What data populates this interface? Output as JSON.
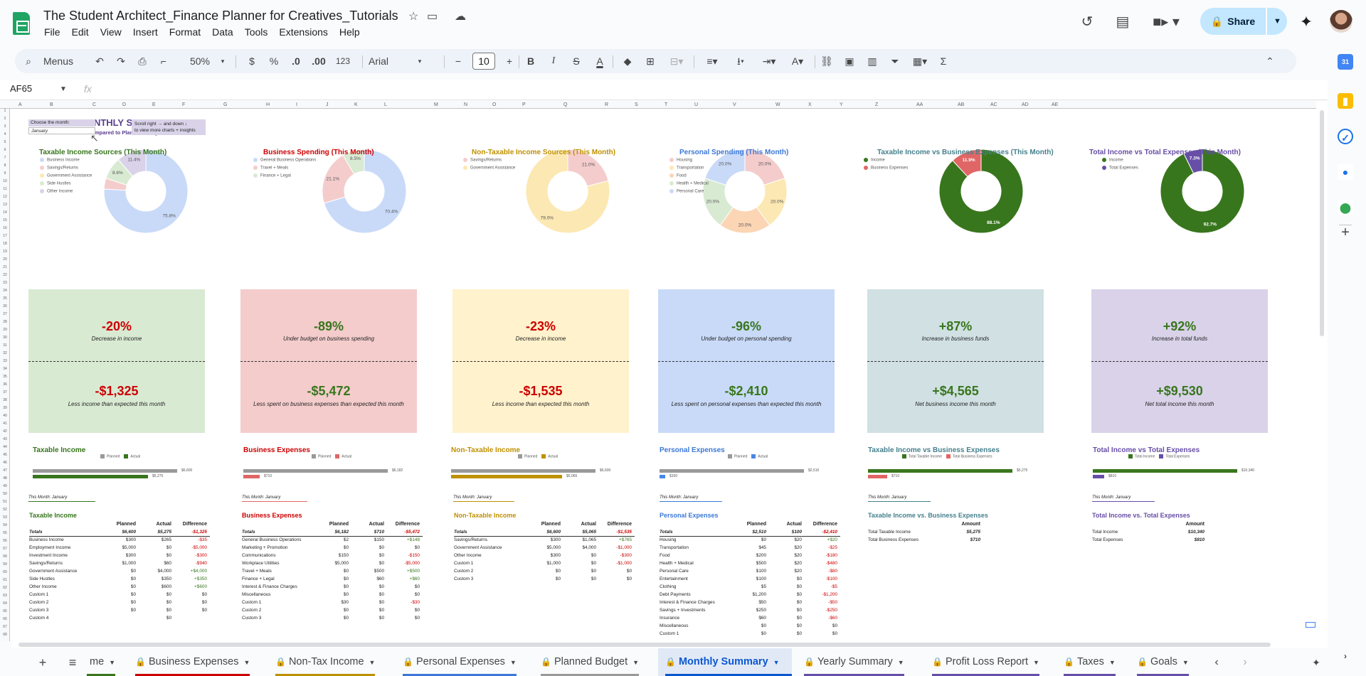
{
  "app": {
    "title": "The Student Architect_Finance Planner for Creatives_Tutorials",
    "menus": [
      "File",
      "Edit",
      "View",
      "Insert",
      "Format",
      "Data",
      "Tools",
      "Extensions",
      "Help"
    ],
    "share_label": "Share"
  },
  "toolbar": {
    "menus_label": "Menus",
    "zoom": "50%",
    "currency": "$",
    "percent": "%",
    "dec_decrease": ".0",
    "dec_increase": ".00",
    "number_format": "123",
    "font": "Arial",
    "font_size": "10",
    "bold": "B",
    "italic": "I",
    "strike": "S",
    "text_color": "A"
  },
  "formula_bar": {
    "cell_ref": "AF65",
    "fx": "fx",
    "value": ""
  },
  "columns": [
    "A",
    "B",
    "C",
    "D",
    "E",
    "F",
    "G",
    "H",
    "I",
    "J",
    "K",
    "L",
    "M",
    "N",
    "O",
    "P",
    "Q",
    "R",
    "S",
    "T",
    "U",
    "V",
    "W",
    "X",
    "Y",
    "Z",
    "AA",
    "AB",
    "AC",
    "AD",
    "AE"
  ],
  "summary": {
    "title": "MONTHLY SUMMARY",
    "subtitle": "Compared to Planned Budget",
    "choose_label": "Choose the month:",
    "selected_month": "January",
    "hint_line1": "Scroll right →   and down  ↓",
    "hint_line2": "to view more charts + insights"
  },
  "chart_data": [
    {
      "type": "pie",
      "title": "Taxable Income Sources (This Month)",
      "labels": [
        "Business Income",
        "Savings/Returns",
        "Government Assistance",
        "Side Hustles",
        "Other Income"
      ],
      "values": [
        75.8,
        4.2,
        0,
        8.6,
        11.4
      ],
      "slice_labels": [
        "75.8%",
        "",
        "",
        "8.6%",
        "11.4%"
      ],
      "colors": [
        "#c9daf8",
        "#f4cccc",
        "#fce8b2",
        "#d9ead3",
        "#d9d2e9"
      ]
    },
    {
      "type": "pie",
      "title": "Business Spending (This Month)",
      "labels": [
        "General Business Operations",
        "Travel + Meals",
        "Finance + Legal"
      ],
      "values": [
        70.4,
        21.1,
        8.5
      ],
      "slice_labels": [
        "70.4%",
        "21.1%",
        "8.5%"
      ],
      "colors": [
        "#c9daf8",
        "#f4cccc",
        "#d9ead3"
      ]
    },
    {
      "type": "pie",
      "title": "Non-Taxable Income Sources (This Month)",
      "labels": [
        "Savings/Returns",
        "Government Assistance"
      ],
      "values": [
        21.0,
        79.0
      ],
      "slice_labels": [
        "21.0%",
        "79.0%"
      ],
      "colors": [
        "#f4cccc",
        "#fce8b2"
      ]
    },
    {
      "type": "pie",
      "title": "Personal Spending (This Month)",
      "labels": [
        "Housing",
        "Transportation",
        "Food",
        "Health + Medical",
        "Personal Care"
      ],
      "values": [
        20.0,
        20.0,
        20.0,
        20.0,
        20.0
      ],
      "slice_labels": [
        "20.0%",
        "20.0%",
        "20.0%",
        "20.0%",
        "20.0%"
      ],
      "colors": [
        "#f4cccc",
        "#fce8b2",
        "#fcd5b4",
        "#d9ead3",
        "#c9daf8"
      ]
    },
    {
      "type": "pie",
      "title": "Taxable Income vs Business Expenses (This Month)",
      "labels": [
        "Income",
        "Business Expenses"
      ],
      "values": [
        88.1,
        11.9
      ],
      "slice_labels": [
        "88.1%",
        "11.9%"
      ],
      "colors": [
        "#38761d",
        "#e06666"
      ]
    },
    {
      "type": "pie",
      "title": "Total Income vs Total Expenses (This Month)",
      "labels": [
        "Income",
        "Total Expenses"
      ],
      "values": [
        92.7,
        7.3
      ],
      "slice_labels": [
        "92.7%",
        "7.3%"
      ],
      "colors": [
        "#38761d",
        "#674ea7"
      ]
    },
    {
      "type": "bar",
      "title": "Taxable Income",
      "series": [
        {
          "name": "Planned",
          "values": [
            6600
          ]
        },
        {
          "name": "Actual",
          "values": [
            5275
          ]
        }
      ],
      "value_labels": [
        "$6,600",
        "$5,275"
      ],
      "colors": [
        "#999999",
        "#38761d"
      ]
    },
    {
      "type": "bar",
      "title": "Business Expenses",
      "series": [
        {
          "name": "Planned",
          "values": [
            6182
          ]
        },
        {
          "name": "Actual",
          "values": [
            710
          ]
        }
      ],
      "value_labels": [
        "$6,182",
        "$710"
      ],
      "colors": [
        "#999999",
        "#e06666"
      ]
    },
    {
      "type": "bar",
      "title": "Non-Taxable Income",
      "series": [
        {
          "name": "Planned",
          "values": [
            6600
          ]
        },
        {
          "name": "Actual",
          "values": [
            5065
          ]
        }
      ],
      "value_labels": [
        "$6,600",
        "$5,065"
      ],
      "colors": [
        "#999999",
        "#bf9000"
      ]
    },
    {
      "type": "bar",
      "title": "Personal Expenses",
      "series": [
        {
          "name": "Planned",
          "values": [
            2510
          ]
        },
        {
          "name": "Actual",
          "values": [
            100
          ]
        }
      ],
      "value_labels": [
        "$2,510",
        "$100"
      ],
      "colors": [
        "#999999",
        "#4a86e8"
      ]
    },
    {
      "type": "bar",
      "title": "Taxable Income vs Business Expenses",
      "series": [
        {
          "name": "Total Taxable Income",
          "values": [
            5275
          ]
        },
        {
          "name": "Total Business Expenses",
          "values": [
            710
          ]
        }
      ],
      "value_labels": [
        "$5,275",
        "$710"
      ],
      "colors": [
        "#38761d",
        "#e06666"
      ]
    },
    {
      "type": "bar",
      "title": "Total Income vs Total Expenses",
      "series": [
        {
          "name": "Total Income",
          "values": [
            10340
          ]
        },
        {
          "name": "Total Expenses",
          "values": [
            810
          ]
        }
      ],
      "value_labels": [
        "$10,340",
        "$810"
      ],
      "colors": [
        "#38761d",
        "#674ea7"
      ]
    }
  ],
  "kpis": [
    {
      "bg": "#d9ead3",
      "pct": "-20%",
      "pct_label": "Decrease in income",
      "amt": "-$1,325",
      "amt_label": "Less income than expected this month",
      "pct_color": "#cc0000",
      "amt_color": "#cc0000"
    },
    {
      "bg": "#f4cccc",
      "pct": "-89%",
      "pct_label": "Under budget on business spending",
      "amt": "-$5,472",
      "amt_label": "Less spent on business expenses than expected this month",
      "pct_color": "#38761d",
      "amt_color": "#38761d"
    },
    {
      "bg": "#fff2cc",
      "pct": "-23%",
      "pct_label": "Decrease in income",
      "amt": "-$1,535",
      "amt_label": "Less income than expected this month",
      "pct_color": "#cc0000",
      "amt_color": "#cc0000"
    },
    {
      "bg": "#c9daf8",
      "pct": "-96%",
      "pct_label": "Under budget on personal spending",
      "amt": "-$2,410",
      "amt_label": "Less spent on personal expenses than expected this month",
      "pct_color": "#38761d",
      "amt_color": "#38761d"
    },
    {
      "bg": "#d0e0e3",
      "pct": "+87%",
      "pct_label": "Increase in business funds",
      "amt": "+$4,565",
      "amt_label": "Net business income this month",
      "pct_color": "#38761d",
      "amt_color": "#38761d"
    },
    {
      "bg": "#d9d2e9",
      "pct": "+92%",
      "pct_label": "Increase in total funds",
      "amt": "+$9,530",
      "amt_label": "Net total income this month",
      "pct_color": "#38761d",
      "amt_color": "#38761d"
    }
  ],
  "tables": {
    "month_label": "This Month: January",
    "headers": [
      "Planned",
      "Actual",
      "Difference"
    ],
    "amount_header": "Amount",
    "taxable": {
      "title": "Taxable Income",
      "rows": [
        [
          "Totals",
          "$6,600",
          "$5,275",
          "-$1,325"
        ],
        [
          "Business Income",
          "$300",
          "$265",
          "-$35"
        ],
        [
          "Employment Income",
          "$5,000",
          "$0",
          "-$5,000"
        ],
        [
          "Investment Income",
          "$300",
          "$0",
          "-$300"
        ],
        [
          "Savings/Returns",
          "$1,000",
          "$60",
          "-$940"
        ],
        [
          "Government Assistance",
          "$0",
          "$4,000",
          "+$4,000"
        ],
        [
          "Side Hustles",
          "$0",
          "$350",
          "+$350"
        ],
        [
          "Other Income",
          "$0",
          "$600",
          "+$600"
        ],
        [
          "Custom 1",
          "$0",
          "$0",
          "$0"
        ],
        [
          "Custom 2",
          "$0",
          "$0",
          "$0"
        ],
        [
          "Custom 3",
          "$0",
          "$0",
          "$0"
        ],
        [
          "Custom 4",
          "",
          "$0",
          ""
        ]
      ]
    },
    "business": {
      "title": "Business Expenses",
      "rows": [
        [
          "Totals",
          "$6,182",
          "$710",
          "-$5,472"
        ],
        [
          "General Business Operations",
          "$2",
          "$150",
          "+$148"
        ],
        [
          "Marketing + Promotion",
          "$0",
          "$0",
          "$0"
        ],
        [
          "Communications",
          "$150",
          "$0",
          "-$150"
        ],
        [
          "Workplace Utilities",
          "$5,000",
          "$0",
          "-$5,000"
        ],
        [
          "Travel + Meals",
          "$0",
          "$500",
          "+$500"
        ],
        [
          "Finance + Legal",
          "$0",
          "$60",
          "+$60"
        ],
        [
          "Interest & Finance Charges",
          "$0",
          "$0",
          "$0"
        ],
        [
          "Miscellaneous",
          "$0",
          "$0",
          "$0"
        ],
        [
          "Custom 1",
          "$30",
          "$0",
          "-$30"
        ],
        [
          "Custom 2",
          "$0",
          "$0",
          "$0"
        ],
        [
          "Custom 3",
          "$0",
          "$0",
          "$0"
        ]
      ]
    },
    "nontax": {
      "title": "Non-Taxable Income",
      "rows": [
        [
          "Totals",
          "$6,600",
          "$5,065",
          "-$1,535"
        ],
        [
          "Savings/Returns",
          "$300",
          "$1,065",
          "+$765"
        ],
        [
          "Government Assistance",
          "$5,000",
          "$4,000",
          "-$1,000"
        ],
        [
          "Other Income",
          "$300",
          "$0",
          "-$300"
        ],
        [
          "Custom 1",
          "$1,000",
          "$0",
          "-$1,000"
        ],
        [
          "Custom 2",
          "$0",
          "$0",
          "$0"
        ],
        [
          "Custom 3",
          "$0",
          "$0",
          "$0"
        ]
      ]
    },
    "personal": {
      "title": "Personal Expenses",
      "rows": [
        [
          "Totals",
          "$2,510",
          "$100",
          "-$2,410"
        ],
        [
          "Housing",
          "$0",
          "$20",
          "+$20"
        ],
        [
          "Transportation",
          "$45",
          "$20",
          "-$25"
        ],
        [
          "Food",
          "$200",
          "$20",
          "-$180"
        ],
        [
          "Health + Medical",
          "$500",
          "$20",
          "-$480"
        ],
        [
          "Personal Care",
          "$100",
          "$20",
          "-$80"
        ],
        [
          "Entertainment",
          "$100",
          "$0",
          "-$100"
        ],
        [
          "Clothing",
          "$5",
          "$0",
          "-$5"
        ],
        [
          "Debt Payments",
          "$1,200",
          "$0",
          "-$1,200"
        ],
        [
          "Interest & Finance Charges",
          "$50",
          "$0",
          "-$50"
        ],
        [
          "Savings + Investments",
          "$250",
          "$0",
          "-$250"
        ],
        [
          "Insurance",
          "$60",
          "$0",
          "-$60"
        ],
        [
          "Miscellaneous",
          "$0",
          "$0",
          "$0"
        ],
        [
          "Custom 1",
          "$0",
          "$0",
          "$0"
        ]
      ]
    },
    "tax_vs_biz": {
      "title": "Taxable Income vs. Business Expenses",
      "rows": [
        [
          "Total Taxable Income",
          "$5,275"
        ],
        [
          "Total Business Expenses",
          "$710"
        ]
      ]
    },
    "total_vs_exp": {
      "title": "Total Income vs. Total Expenses",
      "rows": [
        [
          "Total Income",
          "$10,340"
        ],
        [
          "Total Expenses",
          "$810"
        ]
      ]
    }
  },
  "sheet_tabs": [
    {
      "label": "me",
      "lock": false,
      "color": "#38761d"
    },
    {
      "label": "Business Expenses",
      "lock": true,
      "color": "#cc0000"
    },
    {
      "label": "Non-Tax Income",
      "lock": true,
      "color": "#bf9000"
    },
    {
      "label": "Personal Expenses",
      "lock": true,
      "color": "#3c78d8"
    },
    {
      "label": "Planned Budget",
      "lock": true,
      "color": "#999999"
    },
    {
      "label": "Monthly Summary",
      "lock": true,
      "color": "#0b57d0",
      "active": true
    },
    {
      "label": "Yearly Summary",
      "lock": true,
      "color": "#674ea7"
    },
    {
      "label": "Profit Loss Report",
      "lock": true,
      "color": "#674ea7"
    },
    {
      "label": "Taxes",
      "lock": true,
      "color": "#674ea7"
    },
    {
      "label": "Goals",
      "lock": true,
      "color": "#674ea7"
    }
  ]
}
